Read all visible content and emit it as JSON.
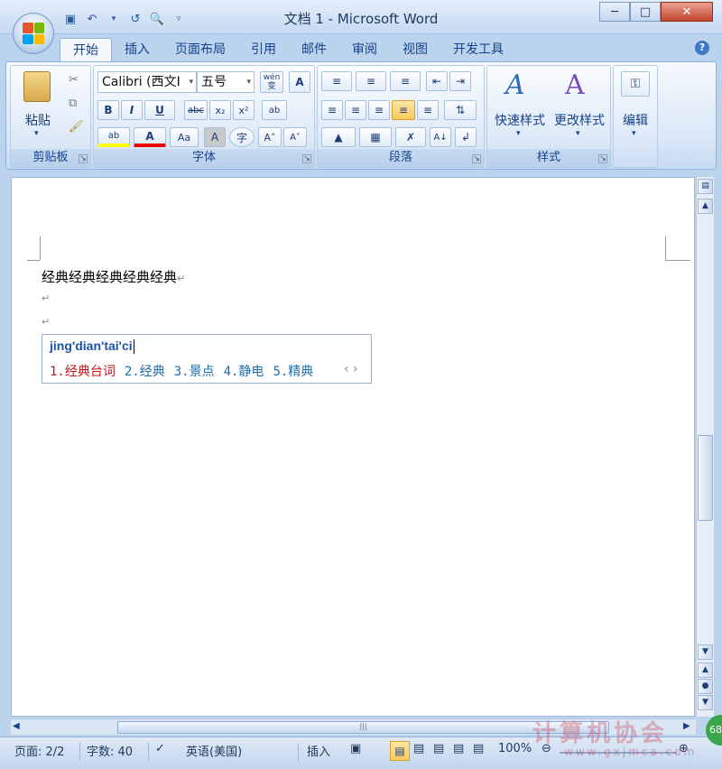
{
  "window": {
    "title": "文档 1 - Microsoft Word",
    "controls": [
      "minimize",
      "maximize",
      "close"
    ]
  },
  "quick_access": {
    "icons": [
      "save-icon",
      "undo-icon",
      "redo-icon",
      "print-preview-icon",
      "customize-icon"
    ]
  },
  "tabs": [
    {
      "label": "开始",
      "active": true
    },
    {
      "label": "插入"
    },
    {
      "label": "页面布局"
    },
    {
      "label": "引用"
    },
    {
      "label": "邮件"
    },
    {
      "label": "审阅"
    },
    {
      "label": "视图"
    },
    {
      "label": "开发工具"
    }
  ],
  "ribbon": {
    "clipboard": {
      "label": "剪贴板",
      "paste_label": "粘贴"
    },
    "font": {
      "label": "字体",
      "font_name": "Calibri (西文I",
      "font_size": "五号",
      "wen_button": "wén 变",
      "char_border": "A",
      "bold": "B",
      "italic": "I",
      "underline": "U",
      "strike": "abc",
      "subscript": "x₂",
      "superscript": "x²",
      "clear": "ab",
      "highlight": "ab",
      "font_color": "A",
      "change_case": "Aa",
      "shading": "A",
      "enclose": "字",
      "grow": "A˄",
      "shrink": "A˅"
    },
    "paragraph": {
      "label": "段落"
    },
    "styles": {
      "label": "样式",
      "quick_styles": "快速样式",
      "change_styles": "更改样式"
    },
    "editing": {
      "label": "编辑"
    }
  },
  "document": {
    "line1": "经典经典经典经典经典",
    "para_mark": "↵"
  },
  "ime": {
    "input": "jing'dian'tai'ci",
    "candidates": [
      "1.经典台词",
      "2.经典",
      "3.景点",
      "4.静电",
      "5.精典"
    ],
    "nav": "‹ ›"
  },
  "status": {
    "page": "页面: 2/2",
    "words": "字数: 40",
    "language": "英语(美国)",
    "mode": "插入",
    "zoom": "100%"
  },
  "watermark": {
    "text": "计算机协会",
    "url": "www.gxjmca.com",
    "badge": "68"
  }
}
